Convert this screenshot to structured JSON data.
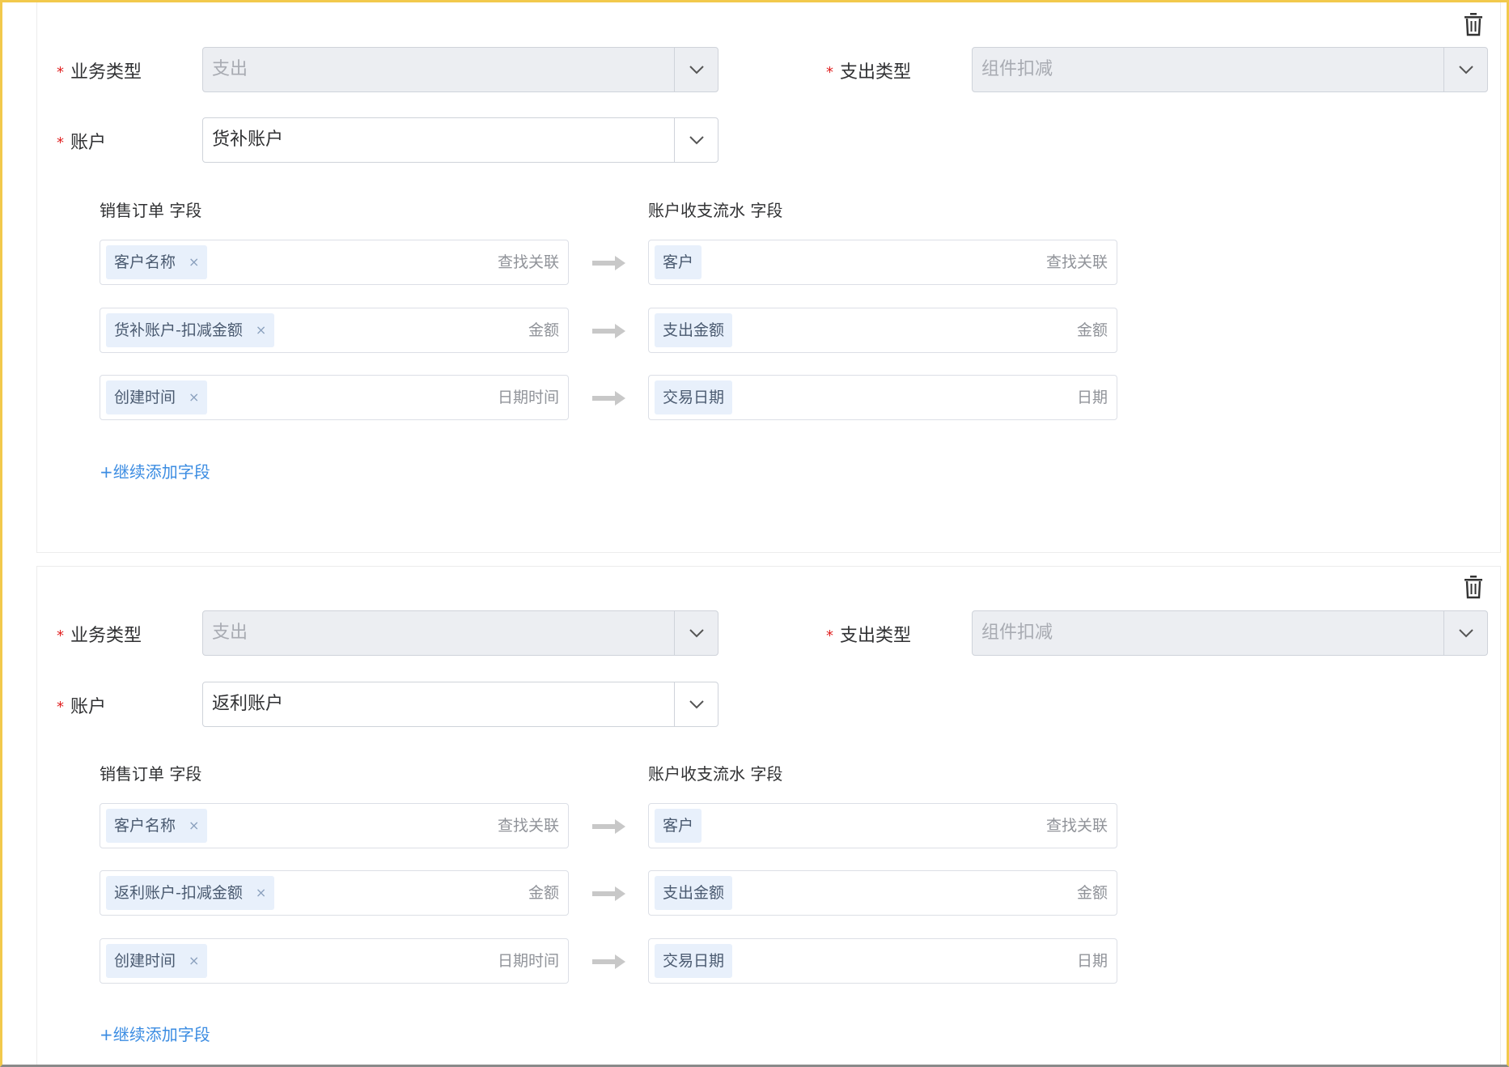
{
  "mappings": [
    {
      "business_type": {
        "label": "业务类型",
        "value": "支出"
      },
      "expense_type": {
        "label": "支出类型",
        "value": "组件扣减"
      },
      "account": {
        "label": "账户",
        "value": "货补账户"
      },
      "source_header": "销售订单 字段",
      "target_header": "账户收支流水 字段",
      "rows": [
        {
          "source_tag": "客户名称",
          "source_hint": "查找关联",
          "target_tag": "客户",
          "target_hint": "查找关联"
        },
        {
          "source_tag": "货补账户-扣减金额",
          "source_hint": "金额",
          "target_tag": "支出金额",
          "target_hint": "金额"
        },
        {
          "source_tag": "创建时间",
          "source_hint": "日期时间",
          "target_tag": "交易日期",
          "target_hint": "日期"
        }
      ],
      "add_field": "+继续添加字段"
    },
    {
      "business_type": {
        "label": "业务类型",
        "value": "支出"
      },
      "expense_type": {
        "label": "支出类型",
        "value": "组件扣减"
      },
      "account": {
        "label": "账户",
        "value": "返利账户"
      },
      "source_header": "销售订单 字段",
      "target_header": "账户收支流水 字段",
      "rows": [
        {
          "source_tag": "客户名称",
          "source_hint": "查找关联",
          "target_tag": "客户",
          "target_hint": "查找关联"
        },
        {
          "source_tag": "返利账户-扣减金额",
          "source_hint": "金额",
          "target_tag": "支出金额",
          "target_hint": "金额"
        },
        {
          "source_tag": "创建时间",
          "source_hint": "日期时间",
          "target_tag": "交易日期",
          "target_hint": "日期"
        }
      ],
      "add_field": "+继续添加字段"
    }
  ],
  "icons": {
    "delete": "trash-icon",
    "dropdown": "chevron-down-icon",
    "map": "arrow-right-icon",
    "remove_tag": "close-icon"
  },
  "colors": {
    "required": "#e02020",
    "link": "#3b8ce2",
    "tag_bg": "#e8f0fb",
    "disabled_bg": "#eceef2"
  },
  "tag_remove_glyph": "×"
}
